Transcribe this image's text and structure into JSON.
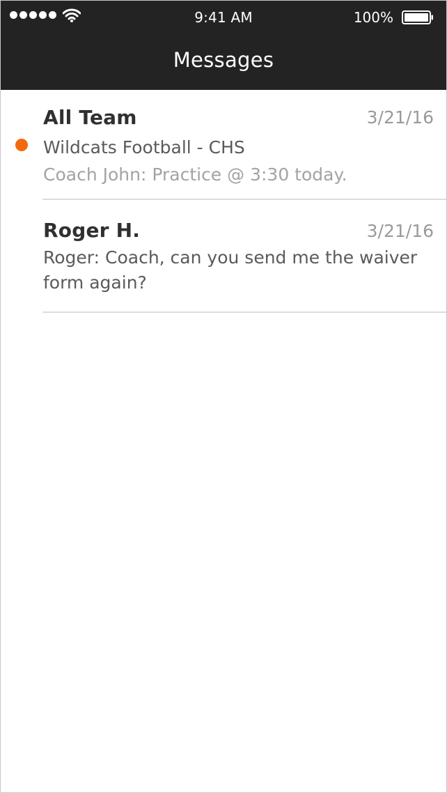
{
  "status_bar": {
    "time": "9:41 AM",
    "battery_percent": "100%",
    "signal_icon": "signal-dots-icon",
    "wifi_icon": "wifi-icon",
    "battery_icon": "battery-icon"
  },
  "nav": {
    "title": "Messages"
  },
  "colors": {
    "nav_background": "#232323",
    "unread_indicator": "#f26a10",
    "divider": "#dcdcdc"
  },
  "conversations": [
    {
      "name": "All Team",
      "date": "3/21/16",
      "unread": true,
      "subtitle": "Wildcats Football - CHS",
      "preview": "Coach John: Practice @ 3:30 today."
    },
    {
      "name": "Roger H.",
      "date": "3/21/16",
      "unread": false,
      "preview": "Roger: Coach, can you send me the waiver form again?"
    }
  ]
}
